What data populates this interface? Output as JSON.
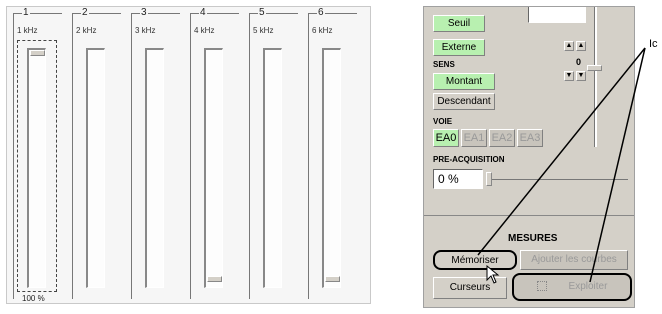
{
  "left_panel": {
    "channels": [
      {
        "num": "1",
        "freq": "1 kHz"
      },
      {
        "num": "2",
        "freq": "2 kHz"
      },
      {
        "num": "3",
        "freq": "3 kHz"
      },
      {
        "num": "4",
        "freq": "4 kHz"
      },
      {
        "num": "5",
        "freq": "5 kHz"
      },
      {
        "num": "6",
        "freq": "6 kHz"
      }
    ],
    "percent_label": "100 %"
  },
  "right_panel": {
    "seuil_label": "Seuil",
    "externe_label": "Externe",
    "sens_heading": "SENS",
    "montant_label": "Montant",
    "descendant_label": "Descendant",
    "voie_heading": "VOIE",
    "voie_buttons": [
      "EA0",
      "EA1",
      "EA2",
      "EA3"
    ],
    "counter_value": "0",
    "preacq_heading": "PRE-ACQUISITION",
    "preacq_value": "0 %",
    "mesures_heading": "MESURES",
    "memoriser_label": "Mémoriser",
    "ajouter_label": "Ajouter les courbes",
    "curseurs_label": "Curseurs",
    "exploiter_label": "Exploiter"
  },
  "callout": {
    "label": "Ic"
  }
}
